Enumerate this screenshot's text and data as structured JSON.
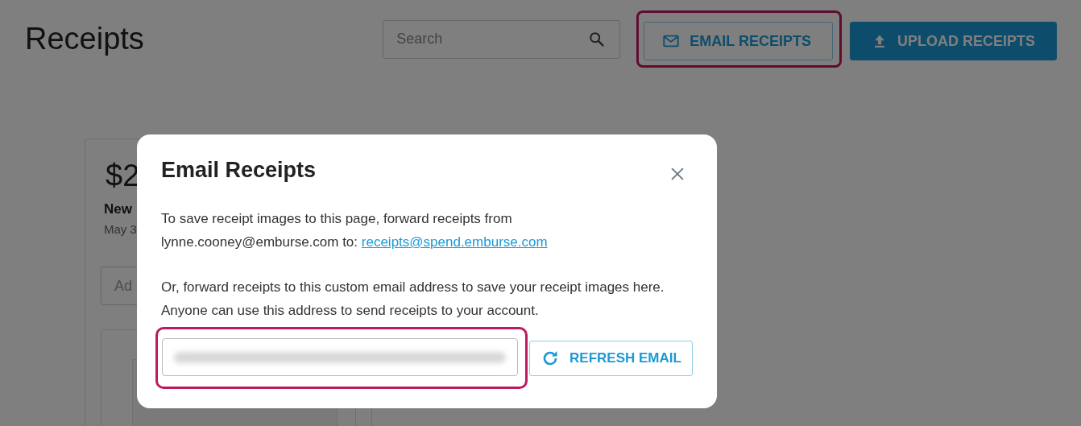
{
  "page": {
    "title": "Receipts",
    "search": {
      "placeholder": "Search"
    },
    "buttons": [
      {
        "label": "EMAIL RECEIPTS",
        "kind": "outline",
        "highlighted": true
      },
      {
        "label": "UPLOAD RECEIPTS",
        "kind": "filled",
        "highlighted": false
      }
    ]
  },
  "card": {
    "amount": "$2",
    "merchant": "New",
    "date": "May 3",
    "note_field": {
      "placeholder": "Ad"
    }
  },
  "dialog": {
    "title": "Email Receipts",
    "paragraphs": [
      {
        "text": "To save receipt images to this page, forward receipts from lynne.cooney@emburse.com to:",
        "link": "receipts@spend.emburse.com"
      },
      {
        "text": "Or, forward receipts to this custom email address to save your receipt images here. Anyone can use this address to send receipts to your account."
      }
    ],
    "custom_email_field": {
      "highlighted": true,
      "blurred": true
    },
    "refresh_button": {
      "label": "REFRESH EMAIL"
    }
  }
}
